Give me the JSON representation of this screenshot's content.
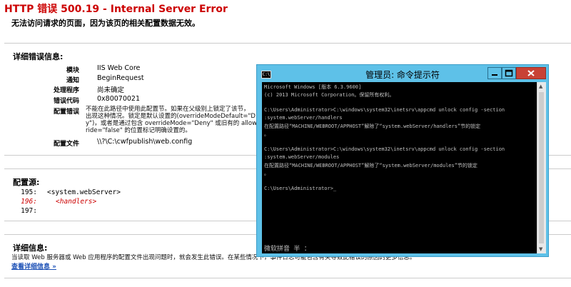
{
  "page": {
    "title": "HTTP 错误 500.19 - Internal Server Error",
    "subtitle": "无法访问请求的页面，因为该页的相关配置数据无效。"
  },
  "detail": {
    "heading": "详细错误信息:",
    "fields": [
      {
        "key": "模块",
        "value": "IIS Web Core"
      },
      {
        "key": "通知",
        "value": "BeginRequest"
      },
      {
        "key": "处理程序",
        "value": "尚未确定"
      },
      {
        "key": "错误代码",
        "value": "0x80070021"
      },
      {
        "key": "配置错误",
        "value": ""
      },
      {
        "key": "配置文件",
        "value": "\\\\?\\C:\\cwfpublish\\web.config"
      }
    ],
    "config_error_lines": [
      "不能在此路径中使用此配置节。如果在父级别上锁定了该节，",
      "出现这种情况。锁定是默认设置的(overrideModeDefault=\"D",
      "y\")，或者是通过包含 overrideMode=\"Deny\" 或旧有的 allow",
      "ride=\"false\" 的位置标记明确设置的。"
    ]
  },
  "source": {
    "heading": "配置源:",
    "lines": [
      {
        "num": "195:",
        "text": "<system.webServer>",
        "highlight": false
      },
      {
        "num": "196:",
        "text": "<handlers>",
        "highlight": true
      },
      {
        "num": "197:",
        "text": "",
        "highlight": false
      }
    ]
  },
  "more": {
    "heading": "详细信息:",
    "text": "当读取 Web 服务器或 Web 应用程序的配置文件出现问题时，就会发生此错误。在某些情况下，事件日志可能包含有关导致此错误的原因的更多信息。",
    "link": "查看详细信息 »"
  },
  "cmd": {
    "title": "管理员: 命令提示符",
    "lines": [
      "Microsoft Windows [版本 6.3.9600]",
      "(c) 2013 Microsoft Corporation。保留所有权利。",
      "",
      "C:\\Users\\Administrator>C:\\windows\\system32\\inetsrv\\appcmd unlock config -section",
      ":system.webServer/handlers",
      "在配置路径“MACHINE/WEBROOT/APPHOST”解除了“system.webServer/handlers”节的锁定",
      "。",
      "",
      "C:\\Users\\Administrator>C:\\windows\\system32\\inetsrv\\appcmd unlock config -section",
      ":system.webServer/modules",
      "在配置路径“MACHINE/WEBROOT/APPHOST”解除了“system.webServer/modules”节的锁定",
      "。",
      "",
      "C:\\Users\\Administrator>_"
    ],
    "ime_status": "微软拼音 半 ："
  }
}
